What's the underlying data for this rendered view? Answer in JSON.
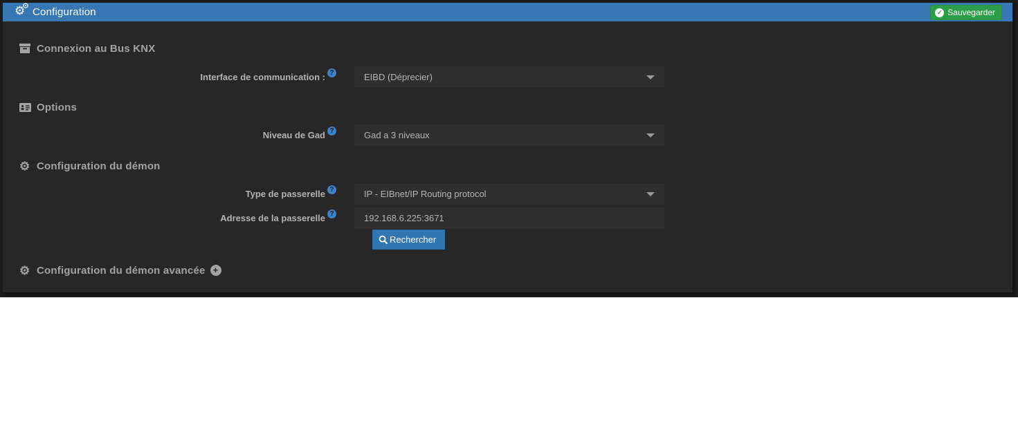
{
  "header": {
    "title": "Configuration",
    "save_button": "Sauvegarder",
    "save_icon": "check-circle-icon",
    "title_icon": "cogs-icon"
  },
  "sections": {
    "knx": {
      "title": "Connexion au Bus KNX",
      "icon": "archive-icon"
    },
    "options": {
      "title": "Options",
      "icon": "address-card-icon"
    },
    "daemon": {
      "title": "Configuration du démon",
      "icon": "gear-icon"
    },
    "daemon_advanced": {
      "title": "Configuration du démon avancée",
      "icon": "gear-icon",
      "expand_icon": "plus-circle-icon"
    }
  },
  "fields": {
    "interface": {
      "label": "Interface de communication :",
      "value": "EIBD (Déprecier)",
      "help_icon": "question-circle-icon"
    },
    "gad_level": {
      "label": "Niveau de Gad",
      "value": "Gad a 3 niveaux",
      "help_icon": "question-circle-icon"
    },
    "gateway_type": {
      "label": "Type de passerelle",
      "value": "IP - EIBnet/IP Routing protocol",
      "help_icon": "question-circle-icon"
    },
    "gateway_address": {
      "label": "Adresse de la passerelle",
      "value": "192.168.6.225:3671",
      "help_icon": "question-circle-icon"
    }
  },
  "buttons": {
    "search": "Rechercher"
  },
  "glyphs": {
    "gear": "⚙",
    "plus": "+",
    "check": "✓",
    "question": "?"
  },
  "colors": {
    "header_blue": "#3877b3",
    "save_green": "#2c9e49",
    "search_blue": "#3276b1",
    "panel_bg": "#272727",
    "field_bg": "#2e2e2e",
    "help_blue": "#3e81c4",
    "outer_bg": "#1d1d1d"
  }
}
